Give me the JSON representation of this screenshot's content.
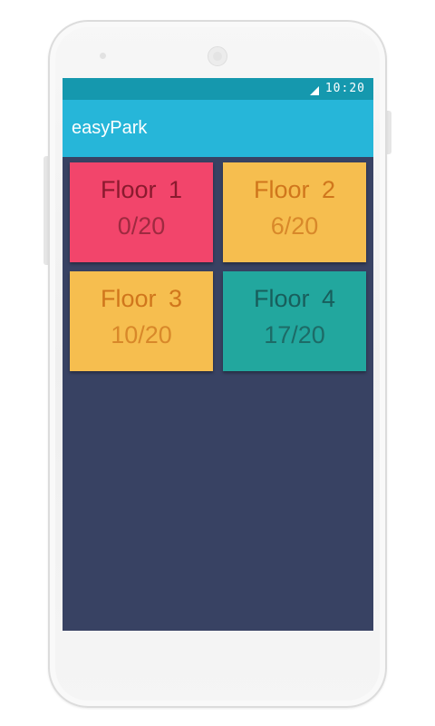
{
  "status_bar": {
    "time": "10:20",
    "icons": [
      "signal-icon"
    ]
  },
  "app_bar": {
    "title": "easyPark"
  },
  "floors": [
    {
      "name": "Floor 1",
      "count": "0/20",
      "color": "#f2456b"
    },
    {
      "name": "Floor 2",
      "count": "6/20",
      "color": "#f6be4f"
    },
    {
      "name": "Floor 3",
      "count": "10/20",
      "color": "#f6be4f"
    },
    {
      "name": "Floor 4",
      "count": "17/20",
      "color": "#22a79e"
    }
  ],
  "colors": {
    "status_bar": "#1598ae",
    "app_bar": "#26b6d9",
    "background": "#384263"
  }
}
